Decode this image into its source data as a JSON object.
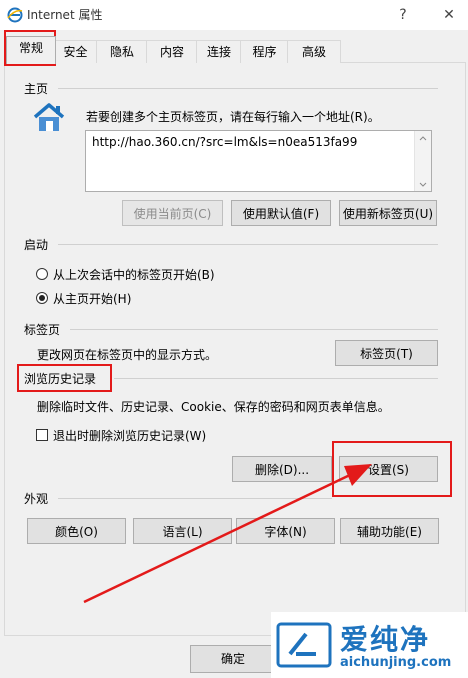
{
  "window": {
    "title": "Internet 属性",
    "help_glyph": "?",
    "close_glyph": "✕"
  },
  "tabs": [
    {
      "label": "常规",
      "active": true
    },
    {
      "label": "安全"
    },
    {
      "label": "隐私"
    },
    {
      "label": "内容"
    },
    {
      "label": "连接"
    },
    {
      "label": "程序"
    },
    {
      "label": "高级"
    }
  ],
  "homepage": {
    "section": "主页",
    "instruction": "若要创建多个主页标签页，请在每行输入一个地址(R)。",
    "url": "http://hao.360.cn/?src=lm&ls=n0ea513fa99",
    "use_current": "使用当前页(C)",
    "use_default": "使用默认值(F)",
    "use_new_tab": "使用新标签页(U)"
  },
  "startup": {
    "section": "启动",
    "option_last_session": "从上次会话中的标签页开始(B)",
    "option_home": "从主页开始(H)",
    "selected": "option_home"
  },
  "tabs_section": {
    "section": "标签页",
    "description": "更改网页在标签页中的显示方式。",
    "button": "标签页(T)"
  },
  "history": {
    "section": "浏览历史记录",
    "description": "删除临时文件、历史记录、Cookie、保存的密码和网页表单信息。",
    "delete_on_exit": "退出时删除浏览历史记录(W)",
    "delete_button": "删除(D)...",
    "settings_button": "设置(S)"
  },
  "appearance": {
    "section": "外观",
    "colors": "颜色(O)",
    "languages": "语言(L)",
    "fonts": "字体(N)",
    "accessibility": "辅助功能(E)"
  },
  "footer": {
    "ok": "确定"
  },
  "watermark": {
    "brand": "爱纯净",
    "url": "aichunjing.com"
  },
  "colors": {
    "annotation_red": "#e31a1a",
    "ie_blue": "#1e73be"
  }
}
